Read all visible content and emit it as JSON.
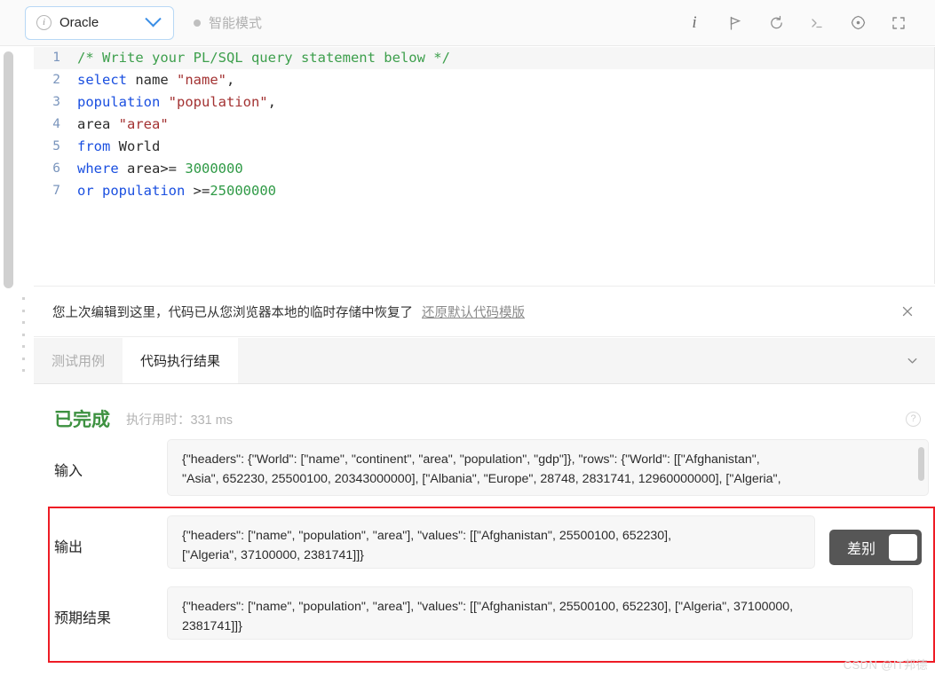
{
  "toolbar": {
    "language": {
      "value": "Oracle",
      "info_icon": "info-circle-icon",
      "chevron_icon": "chevron-down-icon"
    },
    "mode": {
      "label": "智能模式",
      "dot_color": "#bfbfbf"
    },
    "icons": [
      {
        "name": "info-icon",
        "glyph": "i"
      },
      {
        "name": "flag-icon",
        "glyph": "flag"
      },
      {
        "name": "reset-icon",
        "glyph": "undo"
      },
      {
        "name": "console-icon",
        "glyph": ">_"
      },
      {
        "name": "settings-icon",
        "glyph": "gear"
      },
      {
        "name": "fullscreen-icon",
        "glyph": "expand"
      }
    ]
  },
  "editor": {
    "lines": [
      {
        "number": "1",
        "tokens": [
          {
            "t": "comment",
            "v": "/* Write your PL/SQL query statement below */"
          }
        ]
      },
      {
        "number": "2",
        "tokens": [
          {
            "t": "kw",
            "v": "select"
          },
          {
            "t": "plain",
            "v": " name "
          },
          {
            "t": "str",
            "v": "\"name\""
          },
          {
            "t": "op",
            "v": ","
          }
        ]
      },
      {
        "number": "3",
        "tokens": [
          {
            "t": "kw",
            "v": "population "
          },
          {
            "t": "str",
            "v": "\"population\""
          },
          {
            "t": "op",
            "v": ","
          }
        ]
      },
      {
        "number": "4",
        "tokens": [
          {
            "t": "plain",
            "v": "area "
          },
          {
            "t": "str",
            "v": "\"area\""
          }
        ]
      },
      {
        "number": "5",
        "tokens": [
          {
            "t": "kw",
            "v": "from"
          },
          {
            "t": "plain",
            "v": " World"
          }
        ]
      },
      {
        "number": "6",
        "tokens": [
          {
            "t": "kw",
            "v": "where"
          },
          {
            "t": "plain",
            "v": " area"
          },
          {
            "t": "op",
            "v": ">="
          },
          {
            "t": "plain",
            "v": " "
          },
          {
            "t": "num",
            "v": "3000000"
          }
        ]
      },
      {
        "number": "7",
        "tokens": [
          {
            "t": "kw",
            "v": "or population"
          },
          {
            "t": "plain",
            "v": " "
          },
          {
            "t": "op",
            "v": ">="
          },
          {
            "t": "num",
            "v": "25000000"
          }
        ]
      }
    ]
  },
  "notice": {
    "message": "您上次编辑到这里，代码已从您浏览器本地的临时存储中恢复了",
    "link": "还原默认代码模版",
    "close_icon": "close-icon"
  },
  "tabs": [
    {
      "label": "测试用例",
      "active": false
    },
    {
      "label": "代码执行结果",
      "active": true
    }
  ],
  "tabbar": {
    "collapse_icon": "chevron-down-icon"
  },
  "result": {
    "status": "已完成",
    "elapsed_label": "执行用时：",
    "elapsed_value": "331 ms",
    "help_icon": "question-circle-icon",
    "input": {
      "label": "输入",
      "line1": "{\"headers\": {\"World\": [\"name\", \"continent\",    \"area\",    \"population\", \"gdp\"]}, \"rows\": {\"World\": [[\"Afghanistan\",",
      "line2": "\"Asia\", 652230, 25500100, 20343000000], [\"Albania\", \"Europe\", 28748, 2831741, 12960000000], [\"Algeria\","
    },
    "output": {
      "label": "输出",
      "line1": "{\"headers\": [\"name\", \"population\", \"area\"], \"values\": [[\"Afghanistan\", 25500100, 652230],",
      "line2": "[\"Algeria\", 37100000, 2381741]]}"
    },
    "diff_toggle": {
      "label": "差别",
      "on": false
    },
    "expected": {
      "label": "预期结果",
      "line1": "{\"headers\": [\"name\", \"population\", \"area\"], \"values\": [[\"Afghanistan\", 25500100, 652230], [\"Algeria\", 37100000,",
      "line2": "2381741]]}"
    },
    "highlight_color": "#ee1c25"
  },
  "watermark": "CSDN @IT邦德"
}
